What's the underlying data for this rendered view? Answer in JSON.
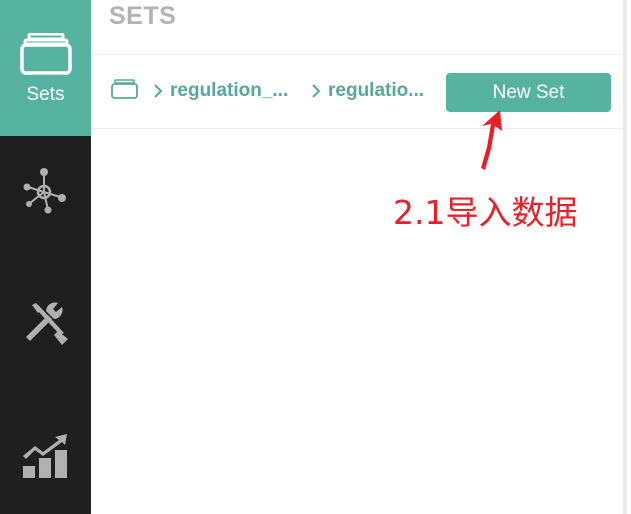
{
  "sidebar": {
    "items": [
      {
        "label": "Sets",
        "icon": "sets-folder-icon",
        "active": true
      },
      {
        "label": "",
        "icon": "network-icon",
        "active": false
      },
      {
        "label": "",
        "icon": "tools-icon",
        "active": false
      },
      {
        "label": "",
        "icon": "analytics-chart-icon",
        "active": false
      }
    ]
  },
  "header": {
    "title": "SETS"
  },
  "breadcrumb": {
    "home_icon": "folder-icon",
    "items": [
      {
        "label": "regulation_..."
      },
      {
        "label": "regulatio..."
      }
    ]
  },
  "toolbar": {
    "new_set_label": "New Set"
  },
  "annotation": {
    "text": "2.1导入数据",
    "color": "#e8202a"
  },
  "colors": {
    "accent": "#56b39f",
    "sidebar_bg": "#1f1f1f",
    "breadcrumb_text": "#56a99a",
    "title_text": "#b3b3b3"
  }
}
